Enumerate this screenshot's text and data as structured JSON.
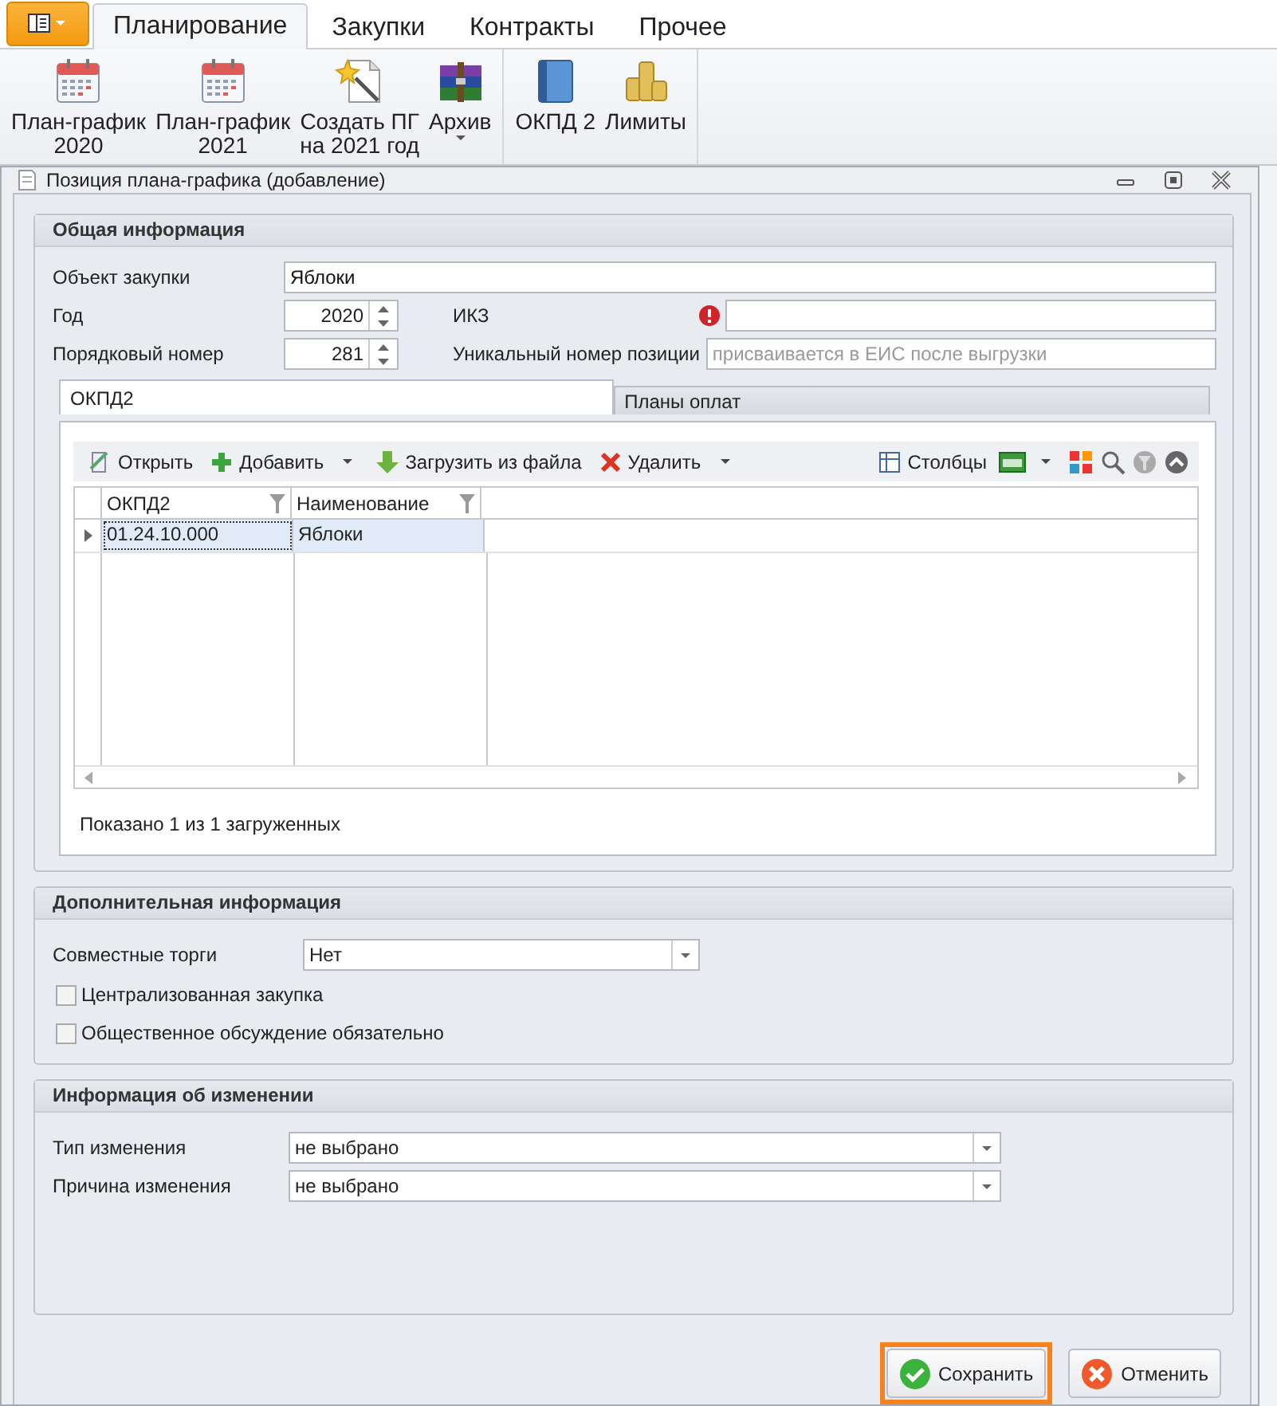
{
  "ribbon_tabs": [
    {
      "label": "Планирование",
      "selected": true
    },
    {
      "label": "Закупки",
      "selected": false
    },
    {
      "label": "Контракты",
      "selected": false
    },
    {
      "label": "Прочее",
      "selected": false
    }
  ],
  "ribbon_groups": [
    [
      {
        "kind": "calendar",
        "lines": [
          "План-график",
          "2020"
        ],
        "dropdown": false
      },
      {
        "kind": "calendar",
        "lines": [
          "План-график",
          "2021"
        ],
        "dropdown": false
      },
      {
        "kind": "wizard",
        "lines": [
          "Создать ПГ",
          "на 2021 год"
        ],
        "dropdown": false
      },
      {
        "kind": "archive",
        "lines": [
          "Архив"
        ],
        "dropdown": true
      }
    ],
    [
      {
        "kind": "book",
        "lines": [
          "ОКПД 2"
        ],
        "dropdown": false
      },
      {
        "kind": "coins",
        "lines": [
          "Лимиты"
        ],
        "dropdown": false
      }
    ]
  ],
  "dialog": {
    "title": "Позиция плана-графика (добавление)"
  },
  "general": {
    "title": "Общая информация",
    "object": {
      "label": "Объект закупки",
      "value": "Яблоки"
    },
    "year": {
      "label": "Год",
      "value": "2020"
    },
    "number": {
      "label": "Порядковый номер",
      "value": "281"
    },
    "ikz": {
      "label": "ИКЗ",
      "error": true
    },
    "unique": {
      "label": "Уникальный номер позиции",
      "placeholder": "присваивается в ЕИС после выгрузки"
    },
    "tabs": [
      {
        "label": "ОКПД2",
        "selected": true
      },
      {
        "label": "Планы оплат",
        "selected": false
      }
    ],
    "toolbar_left": [
      {
        "kind": "open",
        "label": "Открыть",
        "dropdown": false
      },
      {
        "kind": "add",
        "label": "Добавить",
        "dropdown": true
      },
      {
        "kind": "load",
        "label": "Загрузить из файла",
        "dropdown": false
      },
      {
        "kind": "delete",
        "label": "Удалить",
        "dropdown": true
      }
    ],
    "toolbar_right": [
      {
        "kind": "columns",
        "label": "Столбцы",
        "dropdown": false
      },
      {
        "kind": "xls",
        "dropdown": true
      },
      {
        "kind": "layout",
        "dropdown": false
      },
      {
        "kind": "search",
        "dropdown": false
      },
      {
        "kind": "filter",
        "dropdown": false
      },
      {
        "kind": "collapse",
        "dropdown": false
      }
    ],
    "grid": {
      "columns": [
        {
          "title": "ОКПД2"
        },
        {
          "title": "Наименование"
        }
      ],
      "rows": [
        {
          "cells": [
            "01.24.10.000",
            "Яблоки"
          ],
          "selected": true
        }
      ],
      "status": "Показано 1 из 1 загруженных"
    }
  },
  "additional": {
    "title": "Дополнительная информация",
    "joint": {
      "label": "Совместные торги",
      "value": "Нет"
    },
    "checks": [
      {
        "label": "Централизованная закупка",
        "checked": false
      },
      {
        "label": "Общественное обсуждение обязательно",
        "checked": false
      }
    ]
  },
  "change": {
    "title": "Информация об изменении",
    "fields": [
      {
        "label": "Тип изменения",
        "value": "не выбрано"
      },
      {
        "label": "Причина изменения",
        "value": "не выбрано"
      }
    ]
  },
  "buttons": [
    {
      "kind": "save",
      "label": "Сохранить",
      "focused": true
    },
    {
      "kind": "cancel",
      "label": "Отменить",
      "focused": false
    }
  ]
}
